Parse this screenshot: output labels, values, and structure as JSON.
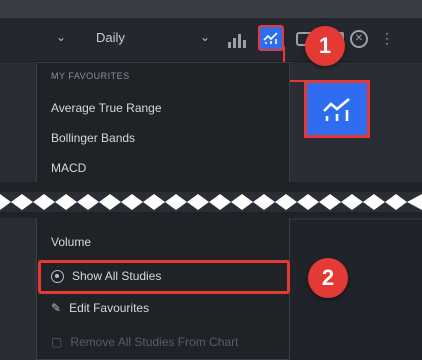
{
  "toolbar": {
    "interval_value": "Daily",
    "chevron_icon": "chevron-down-icon",
    "studies_icon": "studies-icon"
  },
  "menu": {
    "group_title": "MY FAVOURITES",
    "favourites": [
      "Average True Range",
      "Bollinger Bands",
      "MACD"
    ],
    "partial_item": "Volume",
    "actions": {
      "show_all": "Show All Studies",
      "edit": "Edit Favourites",
      "remove_all": "Remove All Studies From Chart"
    }
  },
  "annotations": {
    "step1": "1",
    "step2": "2"
  },
  "colors": {
    "accent_blue": "#2f6df0",
    "annotation_red": "#e53935",
    "menu_bg": "#1f2227"
  }
}
